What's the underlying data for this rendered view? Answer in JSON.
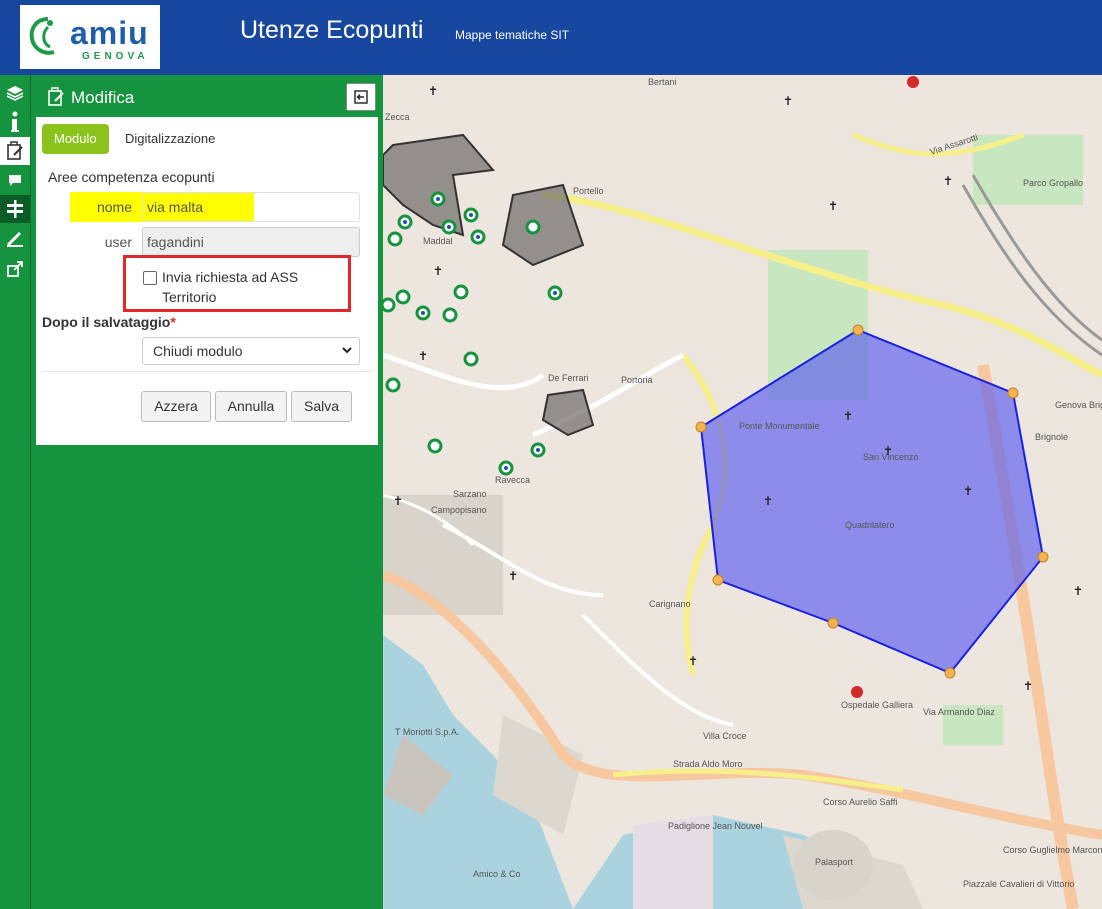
{
  "header": {
    "logo_brand": "amiu",
    "logo_city": "GENOVA",
    "title": "Utenze Ecopunti",
    "subtitle": "Mappe tematiche SIT",
    "background": "#1847a0"
  },
  "toolbar": {
    "items": [
      "layers-icon",
      "info-icon",
      "edit-form-icon",
      "comment-icon",
      "signpost-icon",
      "ruler-icon",
      "share-icon"
    ],
    "active": "signpost-icon",
    "color": "#16933f"
  },
  "panel": {
    "title": "Modifica",
    "tabs": [
      {
        "label": "Modulo",
        "active": true
      },
      {
        "label": "Digitalizzazione",
        "active": false
      }
    ],
    "section_title": "Aree competenza ecopunti",
    "fields": {
      "nome": {
        "label": "nome",
        "value": "via malta"
      },
      "user": {
        "label": "user",
        "value": "fagandini"
      }
    },
    "checkbox": {
      "label": "Invia richiesta ad ASS Territorio",
      "checked": false
    },
    "after_save": {
      "label": "Dopo il salvataggio",
      "required_mark": "*",
      "selected": "Chiudi modulo"
    },
    "buttons": {
      "reset": "Azzera",
      "cancel": "Annulla",
      "save": "Salva"
    },
    "accent": "#8bc21b"
  },
  "map": {
    "labels": {
      "san_vincenzo": "San Vincenzo",
      "quadrilatero": "Quadrilatero",
      "ponte_monumentale": "Ponte Monumentale",
      "carignano": "Carignano",
      "de_ferrari": "De Ferrari",
      "portoria": "Portoria",
      "maddalena": "Maddal",
      "sarzano": "Sarzano",
      "ravecca": "Ravecca",
      "campopisano": "Campopisano",
      "palasport": "Palasport",
      "padiglione": "Padiglione Jean Nouvel",
      "t_moriotti": "T Moriotti S.p.A.",
      "amico": "Amico & Co",
      "piazzale": "Piazzale Cavalieri di Vittorio",
      "ospedale": "Ospedale Galliera",
      "portello": "Portello",
      "zecca": "Zecca",
      "bertani": "Bertani",
      "porto_grapallo": "Parco Gropallo",
      "brignole": "Brignole",
      "genova_brignole": "Genova Brignole",
      "villa_croce": "Villa Croce",
      "corso_aurelio_saffi": "Corso Aurelio Saffi",
      "strada_aldo_moro": "Strada Aldo Moro",
      "via_assarotti": "Via Assarotti",
      "corso_marconi": "Corso Guglielmo Marconi",
      "via_xx_settembre": "Via Armando Diaz"
    },
    "polygon_color": "#5a5cf0",
    "polygon_stroke": "#1a22e0",
    "gray_area_color": "#6e6a66"
  }
}
